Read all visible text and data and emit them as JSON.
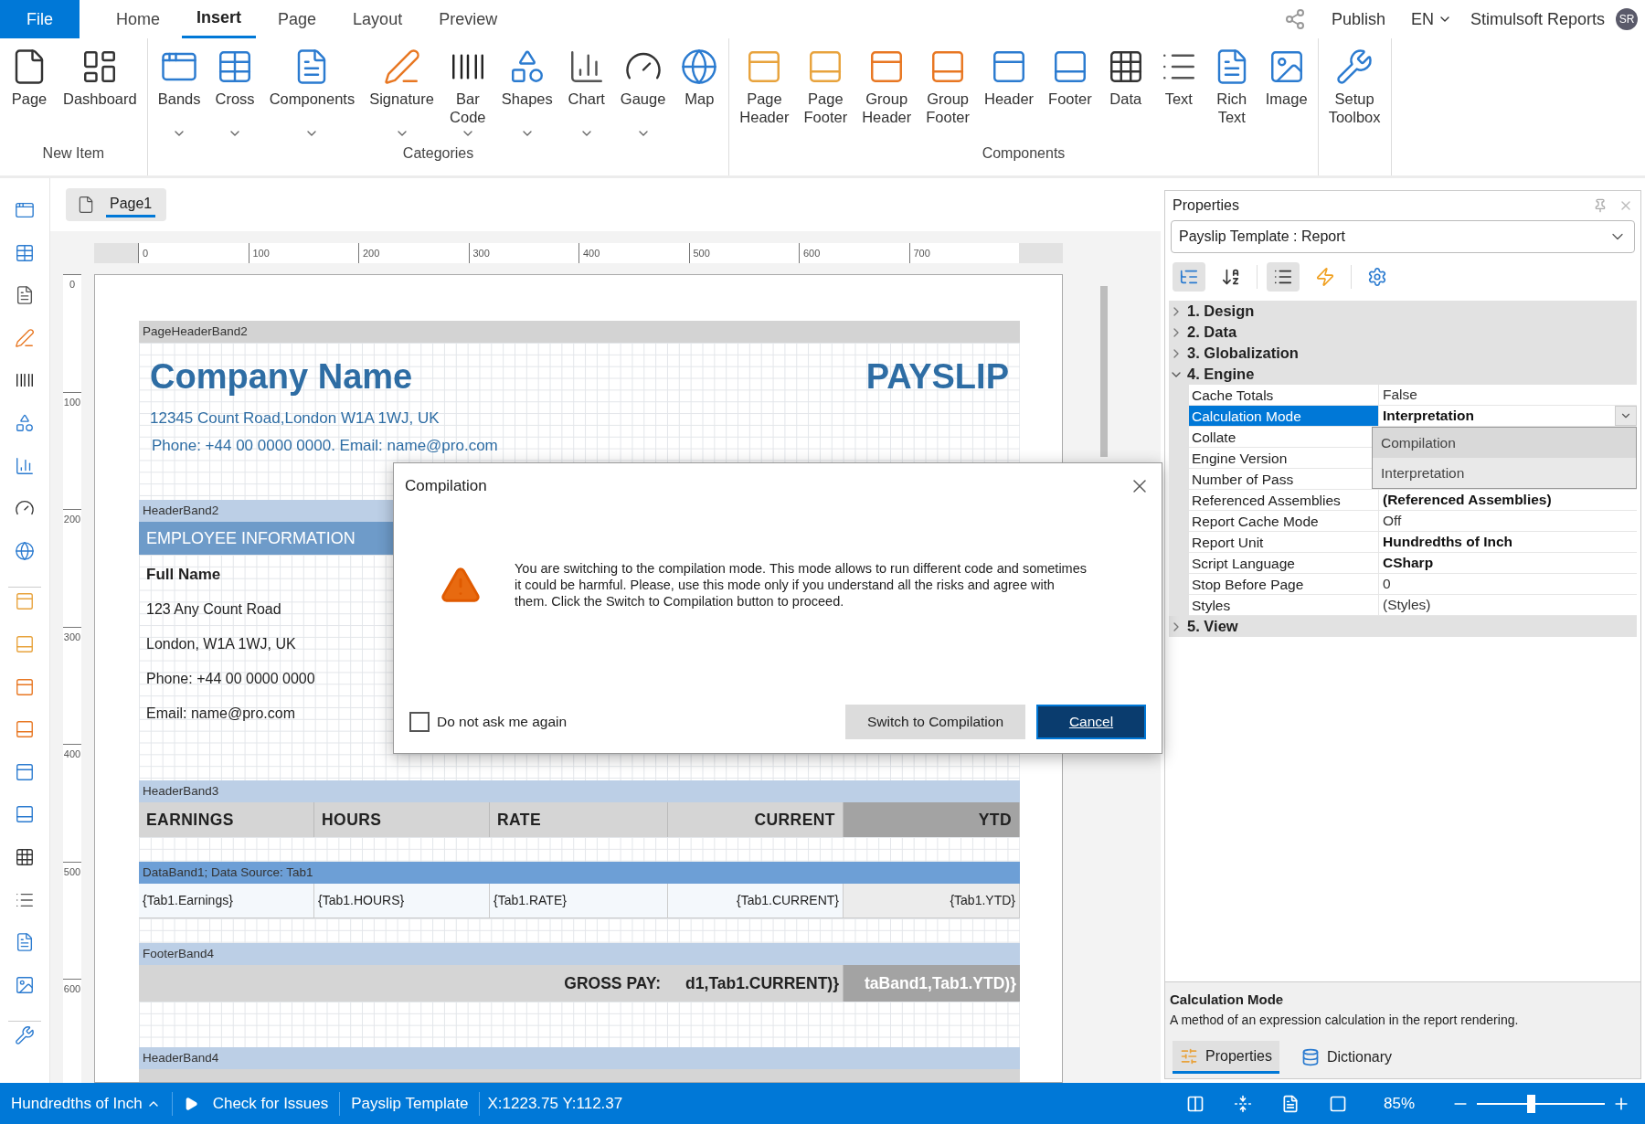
{
  "file_button": "File",
  "menu_tabs": [
    {
      "label": "Home",
      "selected": false
    },
    {
      "label": "Insert",
      "selected": true
    },
    {
      "label": "Page",
      "selected": false
    },
    {
      "label": "Layout",
      "selected": false
    },
    {
      "label": "Preview",
      "selected": false
    }
  ],
  "header_right": {
    "publish": "Publish",
    "language": "EN",
    "account": "Stimulsoft Reports",
    "avatar": "SR"
  },
  "ribbon": {
    "groups": [
      {
        "label": "New Item",
        "items": [
          {
            "label": "Page",
            "dropdown": false
          },
          {
            "label": "Dashboard",
            "dropdown": false
          }
        ]
      },
      {
        "label": "Categories",
        "items": [
          {
            "label": "Bands",
            "dropdown": true
          },
          {
            "label": "Cross",
            "dropdown": true
          },
          {
            "label": "Components",
            "dropdown": true
          },
          {
            "label": "Signature",
            "dropdown": true
          },
          {
            "label": "Bar\nCode",
            "dropdown": true
          },
          {
            "label": "Shapes",
            "dropdown": true
          },
          {
            "label": "Chart",
            "dropdown": true
          },
          {
            "label": "Gauge",
            "dropdown": true
          },
          {
            "label": "Map",
            "dropdown": false
          }
        ]
      },
      {
        "label": "Components",
        "items": [
          {
            "label": "Page\nHeader",
            "dropdown": false
          },
          {
            "label": "Page\nFooter",
            "dropdown": false
          },
          {
            "label": "Group\nHeader",
            "dropdown": false
          },
          {
            "label": "Group\nFooter",
            "dropdown": false
          },
          {
            "label": "Header",
            "dropdown": false
          },
          {
            "label": "Footer",
            "dropdown": false
          },
          {
            "label": "Data",
            "dropdown": false
          },
          {
            "label": "Text",
            "dropdown": false
          },
          {
            "label": "Rich\nText",
            "dropdown": false
          },
          {
            "label": "Image",
            "dropdown": false
          }
        ]
      },
      {
        "items": [
          {
            "label": "Setup\nToolbox",
            "dropdown": false
          }
        ]
      }
    ]
  },
  "page_tabs": [
    {
      "label": "Page1",
      "selected": true
    }
  ],
  "ruler": {
    "horizontal": [
      "0",
      "100",
      "200",
      "300",
      "400",
      "500",
      "600",
      "700"
    ],
    "vertical": [
      "0",
      "100",
      "200",
      "300",
      "400",
      "500",
      "600"
    ]
  },
  "bands": [
    {
      "kind": "page_header",
      "title": "PageHeaderBand2",
      "company": "Company Name",
      "doc_title": "PAYSLIP",
      "address": "12345 Count Road,London W1A 1WJ, UK",
      "contact": "Phone: +44 00 0000 0000. Email: name@pro.com"
    },
    {
      "kind": "employee",
      "title": "HeaderBand2",
      "heading": "EMPLOYEE INFORMATION",
      "lines": [
        "Full Name",
        "123 Any Count Road",
        "London, W1A 1WJ, UK",
        "Phone: +44 00 0000 0000",
        "Email: name@pro.com"
      ]
    },
    {
      "kind": "columns",
      "title": "HeaderBand3",
      "cells": [
        "EARNINGS",
        "HOURS",
        "RATE",
        "CURRENT",
        "YTD"
      ]
    },
    {
      "kind": "data",
      "title": "DataBand1; Data Source: Tab1",
      "cells": [
        "{Tab1.Earnings}",
        "{Tab1.HOURS}",
        "{Tab1.RATE}",
        "{Tab1.CURRENT}",
        "{Tab1.YTD}"
      ]
    },
    {
      "kind": "footer",
      "title": "FooterBand4",
      "label": "GROSS PAY:",
      "cells": [
        "d1,Tab1.CURRENT)}",
        "taBand1,Tab1.YTD)}"
      ]
    },
    {
      "kind": "header_stub",
      "title": "HeaderBand4"
    }
  ],
  "dialog": {
    "title": "Compilation",
    "message": "You are switching to the compilation mode. This mode allows to run different code and sometimes it could be harmful. Please, use this mode only if you understand all the risks and agree with them. Click the Switch to Compilation button to proceed.",
    "checkbox": {
      "label": "Do not ask me again",
      "checked": false
    },
    "buttons": [
      {
        "label": "Switch to Compilation",
        "kind": "secondary"
      },
      {
        "label": "Cancel",
        "kind": "primary"
      }
    ]
  },
  "properties": {
    "title": "Properties",
    "selector": "Payslip Template : Report",
    "toolbar": [
      {
        "kind": "categorized",
        "selected": true
      },
      {
        "kind": "alphabetical",
        "selected": false
      },
      {
        "kind": "properties",
        "selected": true
      },
      {
        "kind": "events",
        "selected": false
      },
      {
        "kind": "settings",
        "selected": false
      }
    ],
    "categories": [
      {
        "label": "1. Design",
        "expanded": false
      },
      {
        "label": "2. Data",
        "expanded": false
      },
      {
        "label": "3. Globalization",
        "expanded": false
      },
      {
        "label": "4. Engine",
        "expanded": true,
        "children": [
          {
            "name": "Cache Totals",
            "value": "False",
            "modified": false,
            "selected": false
          },
          {
            "name": "Calculation Mode",
            "value": "Interpretation",
            "modified": true,
            "selected": true
          },
          {
            "name": "Collate",
            "selected": false
          },
          {
            "name": "Engine Version",
            "selected": false
          },
          {
            "name": "Number of Pass",
            "selected": false
          },
          {
            "name": "Referenced Assemblies",
            "value": "(Referenced Assemblies)",
            "modified": true,
            "selected": false
          },
          {
            "name": "Report Cache Mode",
            "value": "Off",
            "modified": false,
            "selected": false
          },
          {
            "name": "Report Unit",
            "value": "Hundredths of Inch",
            "modified": true,
            "selected": false
          },
          {
            "name": "Script Language",
            "value": "CSharp",
            "modified": true,
            "selected": false
          },
          {
            "name": "Stop Before Page",
            "value": "0",
            "modified": false,
            "selected": false
          },
          {
            "name": "Styles",
            "value": "(Styles)",
            "modified": false,
            "selected": false
          }
        ]
      },
      {
        "label": "5. View",
        "expanded": false
      }
    ],
    "dropdown": {
      "options": [
        {
          "label": "Compilation",
          "highlighted": true
        },
        {
          "label": "Interpretation",
          "highlighted": false
        }
      ]
    },
    "description": {
      "title": "Calculation Mode",
      "text": "A method of an expression calculation in the report rendering."
    },
    "bottom_tabs": [
      {
        "label": "Properties",
        "selected": true
      },
      {
        "label": "Dictionary",
        "selected": false
      }
    ]
  },
  "status_bar": {
    "unit": "Hundredths of Inch",
    "check": "Check for Issues",
    "report": "Payslip Template",
    "coords": "X:1223.75 Y:112.37",
    "zoom": "85%",
    "zoom_slider": {
      "level": 0.42
    }
  }
}
